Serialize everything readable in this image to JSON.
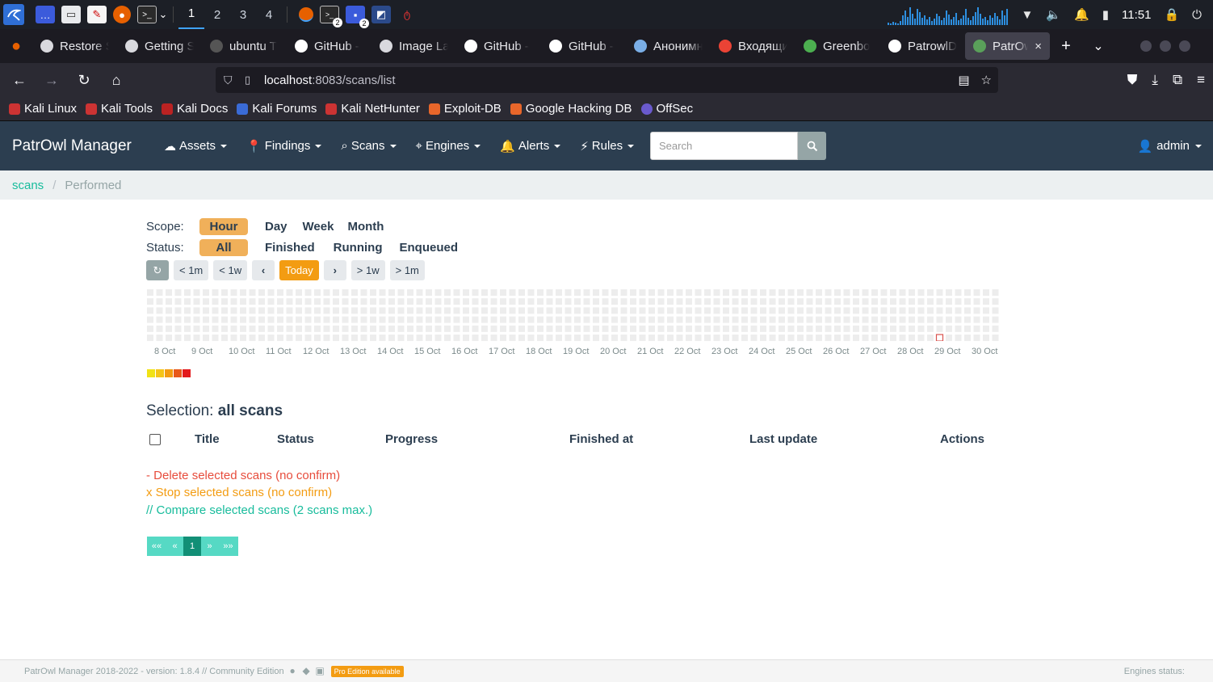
{
  "taskbar": {
    "workspaces": [
      "1",
      "2",
      "3",
      "4"
    ],
    "active_workspace": "1",
    "badge_terminal": "2",
    "badge_files": "2",
    "clock": "11:51"
  },
  "tabs": [
    {
      "label": "Restore S",
      "icon": "info-icon"
    },
    {
      "label": "Getting S",
      "icon": "info-icon"
    },
    {
      "label": "ubuntu T",
      "icon": "ubuntu-icon"
    },
    {
      "label": "GitHub - ",
      "icon": "github-icon"
    },
    {
      "label": "Image La",
      "icon": "image-icon"
    },
    {
      "label": "GitHub - ",
      "icon": "github-icon"
    },
    {
      "label": "GitHub - ",
      "icon": "github-icon"
    },
    {
      "label": "Анонимн",
      "icon": "anon-icon"
    },
    {
      "label": "Входящи",
      "icon": "gmail-icon"
    },
    {
      "label": "Greenbo",
      "icon": "greenbone-icon"
    },
    {
      "label": "PatrowlD",
      "icon": "github-icon"
    },
    {
      "label": "PatrOw",
      "icon": "patrowl-icon"
    }
  ],
  "url": {
    "host": "localhost",
    "path": ":8083/scans/list"
  },
  "bookmarks": [
    "Kali Linux",
    "Kali Tools",
    "Kali Docs",
    "Kali Forums",
    "Kali NetHunter",
    "Exploit-DB",
    "Google Hacking DB",
    "OffSec"
  ],
  "app": {
    "brand": "PatrOwl Manager",
    "menu": [
      "Assets",
      "Findings",
      "Scans",
      "Engines",
      "Alerts",
      "Rules"
    ],
    "search_placeholder": "Search",
    "user": "admin"
  },
  "breadcrumb": {
    "root": "scans",
    "current": "Performed"
  },
  "filters": {
    "scope_label": "Scope:",
    "scope_selected": "Hour",
    "scope_options": [
      "Day",
      "Week",
      "Month"
    ],
    "status_label": "Status:",
    "status_selected": "All",
    "status_options": [
      "Finished",
      "Running",
      "Enqueued"
    ]
  },
  "nav_buttons": {
    "back_month": "< 1m",
    "back_week": "< 1w",
    "today": "Today",
    "fwd_week": "> 1w",
    "fwd_month": "> 1m"
  },
  "heatmap": {
    "days": [
      "8 Oct",
      "9 Oct",
      "10 Oct",
      "11 Oct",
      "12 Oct",
      "13 Oct",
      "14 Oct",
      "15 Oct",
      "16 Oct",
      "17 Oct",
      "18 Oct",
      "19 Oct",
      "20 Oct",
      "21 Oct",
      "22 Oct",
      "23 Oct",
      "24 Oct",
      "25 Oct",
      "26 Oct",
      "27 Oct",
      "28 Oct",
      "29 Oct",
      "30 Oct"
    ],
    "rows_per_day": 6,
    "cols_per_day": 4,
    "highlight_day": "29 Oct",
    "legend_colors": [
      "#f1e216",
      "#f5c518",
      "#f39c12",
      "#e8591a",
      "#e31a1c"
    ],
    "empty_color": "#ededed",
    "highlight_color": "#d9534f"
  },
  "selection": {
    "label": "Selection:",
    "value": "all scans"
  },
  "table": {
    "headers": [
      "Title",
      "Status",
      "Progress",
      "Finished at",
      "Last update",
      "Actions"
    ]
  },
  "actions": {
    "delete": "- Delete selected scans (no confirm)",
    "stop": "x Stop selected scans (no confirm)",
    "compare": "// Compare selected scans (2 scans max.)",
    "delete_color": "#e74c3c",
    "stop_color": "#f39c12",
    "compare_color": "#18bc9c"
  },
  "pager": {
    "first": "««",
    "prev": "«",
    "current": "1",
    "next": "»",
    "last": "»»"
  },
  "footer": {
    "text": "PatrOwl Manager 2018-2022 - version: 1.8.4 // Community Edition",
    "badge": "Pro Edition available",
    "engines_status": "Engines status:"
  }
}
